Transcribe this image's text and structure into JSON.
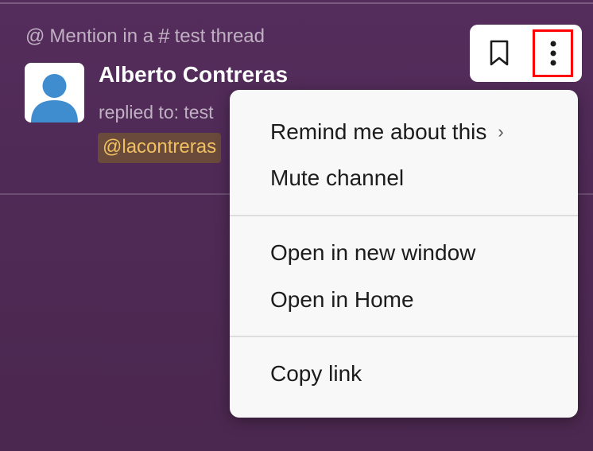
{
  "notification": {
    "prefix": "Mention in a",
    "channel": "test thread",
    "sender": "Alberto Contreras",
    "replied_text": "replied to: test",
    "mention": "@lacontreras"
  },
  "menu": {
    "items": [
      {
        "label": "Remind me about this",
        "has_submenu": true
      },
      {
        "label": "Mute channel"
      },
      {
        "label": "Open in new window"
      },
      {
        "label": "Open in Home"
      },
      {
        "label": "Copy link"
      }
    ]
  },
  "icons": {
    "mention": "at-icon",
    "channel": "hash-icon",
    "bookmark": "bookmark-icon",
    "more": "more-vertical-icon",
    "submenu": "chevron-right-icon"
  },
  "colors": {
    "background": "#4f2a56",
    "mention_text": "#f0c060",
    "highlight_border": "#ff0000",
    "avatar": "#3f8ccf"
  }
}
